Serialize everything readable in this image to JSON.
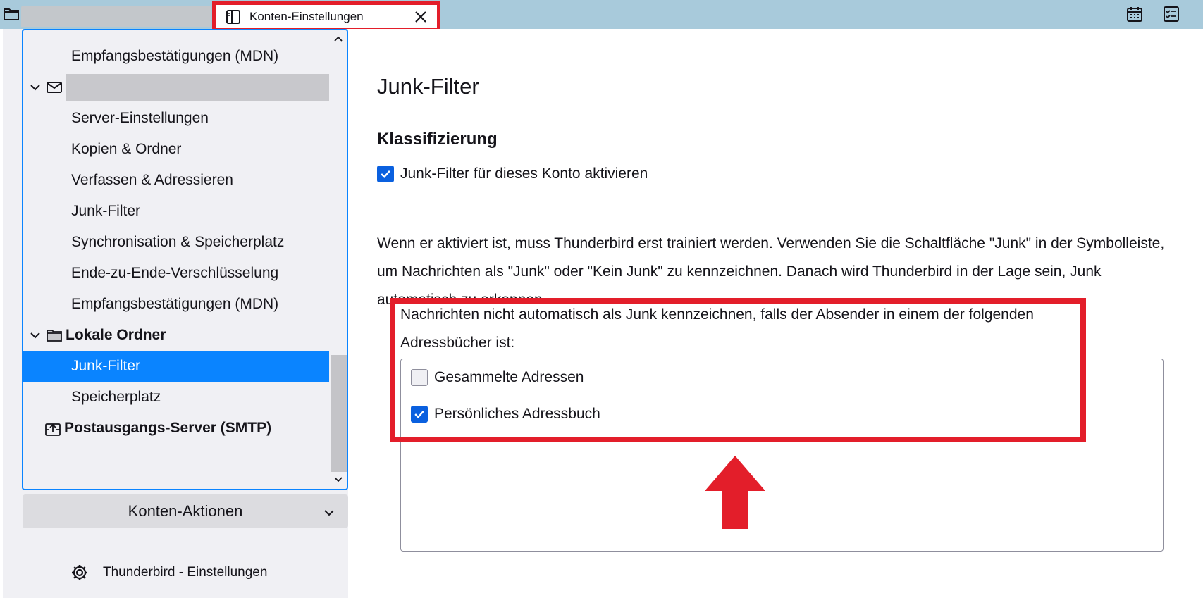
{
  "tabbar": {
    "active_tab_title": "Konten-Einstellungen",
    "icons": [
      "folder-icon",
      "account-settings-icon",
      "close-icon",
      "calendar-icon",
      "tasks-icon"
    ]
  },
  "tree": {
    "items": [
      {
        "label": "Empfangsbestätigungen (MDN)",
        "level": 1
      },
      {
        "label": "",
        "level": 0,
        "icon": "mail-icon",
        "expanded": true
      },
      {
        "label": "Server-Einstellungen",
        "level": 1
      },
      {
        "label": "Kopien & Ordner",
        "level": 1
      },
      {
        "label": "Verfassen & Adressieren",
        "level": 1
      },
      {
        "label": "Junk-Filter",
        "level": 1
      },
      {
        "label": "Synchronisation & Speicherplatz",
        "level": 1
      },
      {
        "label": "Ende-zu-Ende-Verschlüsselung",
        "level": 1
      },
      {
        "label": "Empfangsbestätigungen (MDN)",
        "level": 1
      },
      {
        "label": "Lokale Ordner",
        "level": 0,
        "icon": "folder-icon",
        "expanded": true
      },
      {
        "label": "Junk-Filter",
        "level": 1,
        "selected": true
      },
      {
        "label": "Speicherplatz",
        "level": 1
      },
      {
        "label": "Postausgangs-Server (SMTP)",
        "level": 0,
        "icon": "outbox-icon"
      }
    ]
  },
  "actions": {
    "label": "Konten-Aktionen"
  },
  "settings_link": {
    "label": "Thunderbird - Einstellungen"
  },
  "content": {
    "title": "Junk-Filter",
    "section_title": "Klassifizierung",
    "enable_checkbox": {
      "label": "Junk-Filter für dieses Konto aktivieren",
      "checked": true
    },
    "description": "Wenn er aktiviert ist, muss Thunderbird erst trainiert werden. Verwenden Sie die Schaltfläche \"Junk\" in der Symbolleiste, um Nachrichten als \"Junk\" oder \"Kein Junk\" zu kennzeichnen. Danach wird Thunderbird in der Lage sein, Junk automatisch zu erkennen.",
    "whitelist_label": "Nachrichten nicht automatisch als Junk kennzeichnen, falls der Absender in einem der folgenden Adressbücher ist:",
    "address_books": [
      {
        "label": "Gesammelte Adressen",
        "checked": false
      },
      {
        "label": "Persönliches Adressbuch",
        "checked": true
      }
    ]
  },
  "colors": {
    "accent": "#0a84ff",
    "checkbox_checked": "#0a60df",
    "highlight": "#e31e2a",
    "tabbar": "#a8cadb",
    "sidebar_bg": "#f0f0f4"
  }
}
